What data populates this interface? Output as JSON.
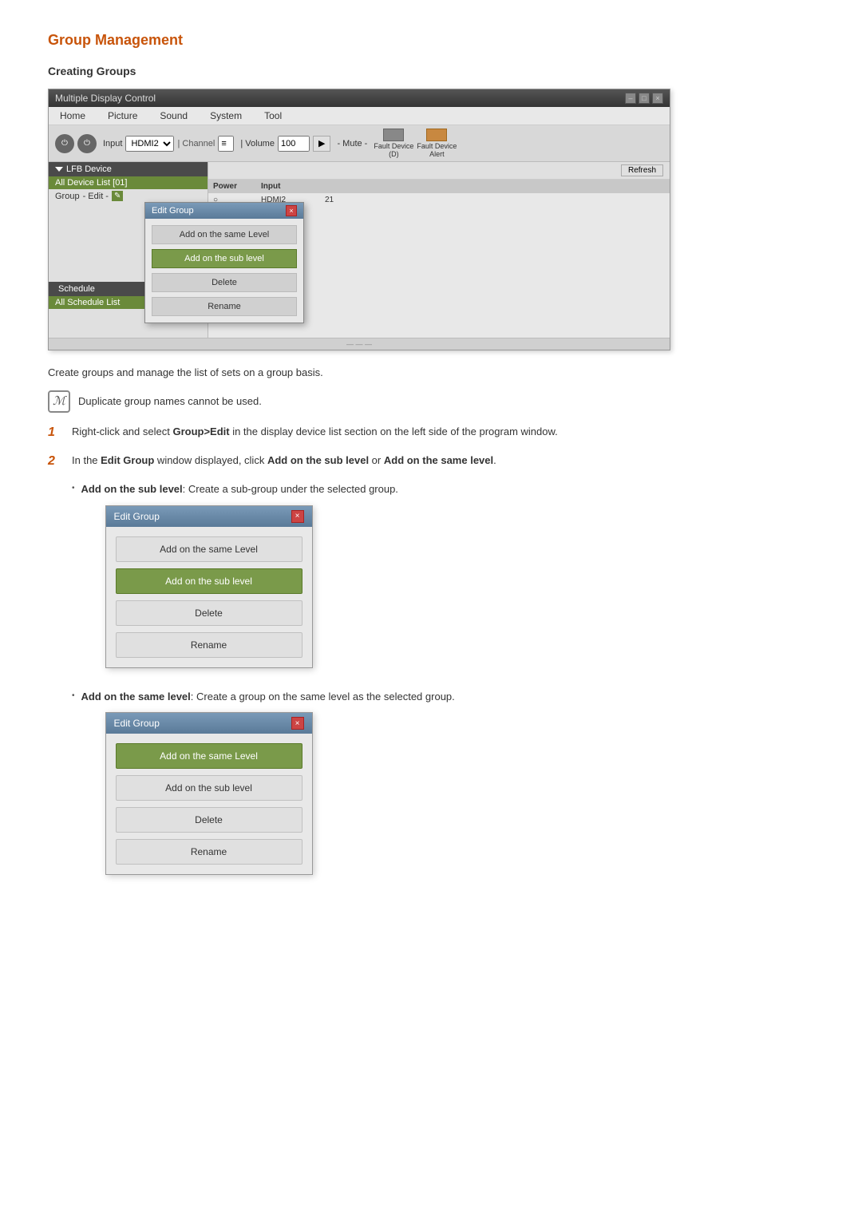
{
  "page": {
    "title": "Group Management",
    "subtitle": "Creating Groups"
  },
  "app_window": {
    "title": "Multiple Display Control",
    "titlebar_buttons": [
      "-",
      "□",
      "×"
    ],
    "menu_items": [
      "Home",
      "Picture",
      "Sound",
      "System",
      "Tool"
    ],
    "toolbar": {
      "input_label": "Input",
      "channel_label": "| Channel",
      "hdmi_value": "HDMI2",
      "volume_label": "| Volume",
      "volume_value": "100",
      "mute_label": "- Mute -",
      "fault_device_label": "Fault Device\n(D)",
      "fault_alert_label": "Fault Device\nAlert"
    },
    "left_panel": {
      "header": "LFB Device",
      "device_list_label": "All Device List [01]",
      "group_label": "Group",
      "edit_label": "- Edit -"
    },
    "right_panel": {
      "refresh_label": "Refresh",
      "columns": [
        "Power",
        "Input"
      ],
      "col_values": [
        "○",
        "HDMI2",
        "21"
      ]
    },
    "edit_group_dialog": {
      "title": "Edit Group",
      "close_btn": "×",
      "buttons": [
        {
          "label": "Add on the same Level",
          "highlighted": false
        },
        {
          "label": "Add on the sub level",
          "highlighted": true
        },
        {
          "label": "Delete",
          "highlighted": false
        },
        {
          "label": "Rename",
          "highlighted": false
        }
      ]
    },
    "schedule": {
      "header": "Schedule",
      "list_label": "All Schedule List"
    }
  },
  "description": "Create groups and manage the list of sets on a group basis.",
  "note": {
    "icon": "ℳ",
    "text": "Duplicate group names cannot be used."
  },
  "steps": [
    {
      "number": "1",
      "text": "Right-click and select Group>Edit in the display device list section on the left side of the program window."
    },
    {
      "number": "2",
      "text": "In the Edit Group window displayed, click Add on the sub level or Add on the same level."
    }
  ],
  "bullet_items": [
    {
      "label": "Add on the sub level",
      "description": ": Create a sub-group under the selected group.",
      "dialog": {
        "title": "Edit Group",
        "highlighted_index": 1,
        "buttons": [
          "Add on the same Level",
          "Add on the sub level",
          "Delete",
          "Rename"
        ]
      }
    },
    {
      "label": "Add on the same level",
      "description": ": Create a group on the same level as the selected group.",
      "dialog": {
        "title": "Edit Group",
        "highlighted_index": 0,
        "buttons": [
          "Add on the same Level",
          "Add on the sub level",
          "Delete",
          "Rename"
        ]
      }
    }
  ]
}
